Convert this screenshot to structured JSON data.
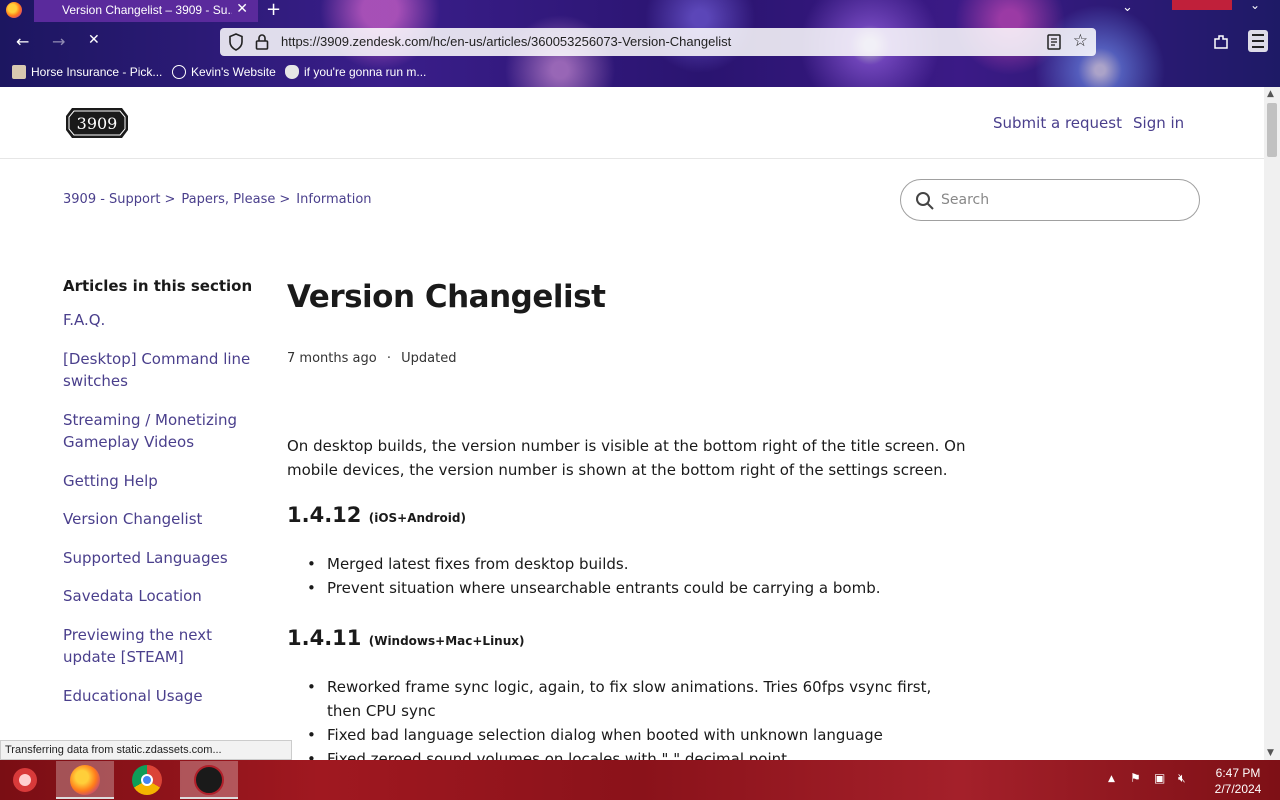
{
  "browser": {
    "tab_title": "Version Changelist – 3909 - Su...",
    "url": "https://3909.zendesk.com/hc/en-us/articles/360053256073-Version-Changelist",
    "bookmarks": [
      {
        "label": "Horse Insurance - Pick...",
        "icon": "horse-icon"
      },
      {
        "label": "Kevin's Website",
        "icon": "globe-icon"
      },
      {
        "label": "if you're gonna run m...",
        "icon": "emblem-icon"
      }
    ],
    "status_text": "Transferring data from static.zdassets.com..."
  },
  "header": {
    "logo_text": "3909",
    "links": [
      "Submit a request",
      "Sign in"
    ]
  },
  "breadcrumb": [
    "3909 - Support",
    "Papers, Please",
    "Information"
  ],
  "search": {
    "placeholder": "Search"
  },
  "sidebar": {
    "title": "Articles in this section",
    "items": [
      "F.A.Q.",
      "[Desktop] Command line switches",
      "Streaming / Monetizing Gameplay Videos",
      "Getting Help",
      "Version Changelist",
      "Supported Languages",
      "Savedata Location",
      "Previewing the next update [STEAM]",
      "Educational Usage"
    ]
  },
  "article": {
    "title": "Version Changelist",
    "meta_time": "7 months ago",
    "meta_dot": "·",
    "meta_updated": "Updated",
    "intro": "On desktop builds, the version number is visible at the bottom right of the title screen. On mobile devices, the version number is shown at the bottom right of the settings screen.",
    "versions": [
      {
        "number": "1.4.12",
        "platform": "(iOS+Android)",
        "changes": [
          "Merged latest fixes from desktop builds.",
          "Prevent situation where unsearchable entrants could be carrying a bomb."
        ]
      },
      {
        "number": "1.4.11",
        "platform": "(Windows+Mac+Linux)",
        "changes": [
          "Reworked frame sync logic, again, to fix slow animations. Tries 60fps vsync first, then CPU sync",
          "Fixed bad language selection dialog when booted with unknown language",
          "Fixed zeroed sound volumes on locales with \",\" decimal point"
        ]
      }
    ]
  },
  "taskbar": {
    "apps": [
      "firefox-icon",
      "chrome-icon",
      "game-icon"
    ],
    "time": "6:47 PM",
    "date": "2/7/2024"
  },
  "colors": {
    "link": "#4a3f8c",
    "chrome_bg": "#2a1470",
    "taskbar_bg": "#8a121a"
  }
}
